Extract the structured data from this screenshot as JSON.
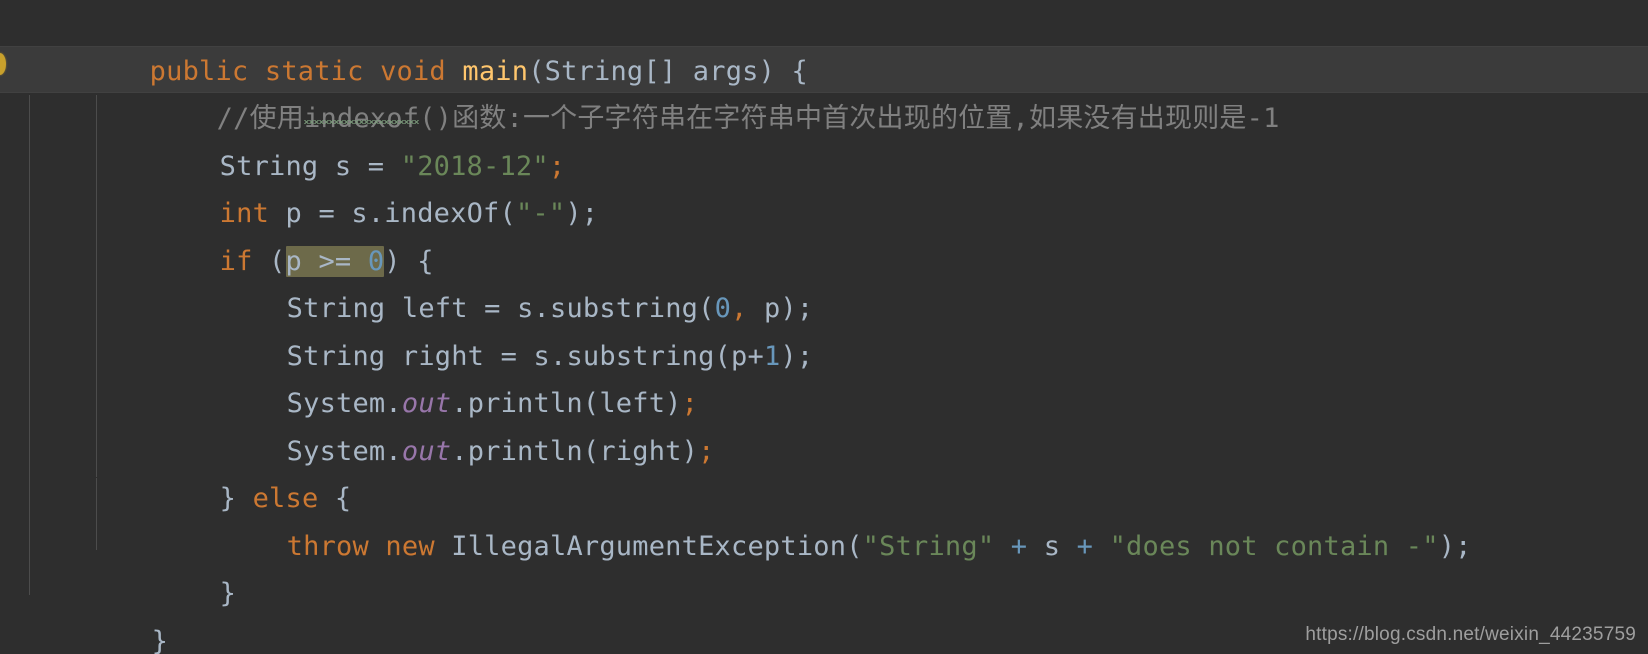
{
  "editor": {
    "language": "Java",
    "theme": "Darcula",
    "colors": {
      "background": "#2e2e2e",
      "current_line": "#3b3b3b",
      "selection": "#6d6a4a",
      "default_text": "#a9b7c6",
      "keyword": "#cc7832",
      "string": "#6a8759",
      "number": "#6897bb",
      "comment": "#808080",
      "static_field": "#9876aa",
      "method_name": "#ffc66d",
      "indent_guide": "#4c4c4c",
      "gutter_marker": "#c8a02c"
    },
    "lines": [
      {
        "n": 1,
        "text": "public static void main(String[] args) {",
        "tokens": {
          "public": "public",
          "static": "static",
          "void": "void",
          "main": "main",
          "open_paren": "(",
          "String_array": "String[]",
          "args": "args",
          "close_paren": ")",
          "open_brace": "{"
        }
      },
      {
        "n": 2,
        "text": "//使用indexof()函数:一个子字符串在字符串中首次出现的位置,如果没有出现则是-1",
        "comment_prefix": "//",
        "comment_part_1": "使用",
        "comment_typo": "indexof",
        "comment_part_2": "()函数:一个子字符串在字符串中首次出现的位置,如果没有出现则是-1",
        "is_current_line": true,
        "has_spell_squiggle": true
      },
      {
        "n": 3,
        "text": "String s = \"2018-12\";",
        "tokens": {
          "type": "String",
          "var": "s",
          "assign": "=",
          "string_literal": "\"2018-12\"",
          "semicolon": ";"
        }
      },
      {
        "n": 4,
        "text": "int p = s.indexOf(\"-\");",
        "tokens": {
          "keyword": "int",
          "var": "p",
          "assign": "=",
          "receiver": "s",
          "method": ".indexOf(",
          "string_literal": "\"-\"",
          "tail": ");"
        }
      },
      {
        "n": 5,
        "text": "if (p >= 0) {",
        "tokens": {
          "keyword": "if",
          "open_paren": "(",
          "selected_var": "p",
          "selected_op": " >= ",
          "selected_num": "0",
          "close_paren": ")",
          "open_brace": "{"
        },
        "has_selection": true,
        "selection_text": "p >= 0"
      },
      {
        "n": 6,
        "text": "String left = s.substring(0, p);",
        "tokens": {
          "type": "String",
          "var": "left",
          "assign": "=",
          "expr_a": "s.substring(",
          "num": "0",
          "comma": ",",
          "arg": " p",
          "tail": ");"
        }
      },
      {
        "n": 7,
        "text": "String right = s.substring(p+1);",
        "tokens": {
          "type": "String",
          "var": "right",
          "assign": "=",
          "expr_a": "s.substring(p+",
          "num": "1",
          "tail": ");"
        }
      },
      {
        "n": 8,
        "text": "System.out.println(left);",
        "tokens": {
          "class": "System",
          "dot1": ".",
          "static_field": "out",
          "call": ".println(left)",
          "semicolon": ";"
        }
      },
      {
        "n": 9,
        "text": "System.out.println(right);",
        "tokens": {
          "class": "System",
          "dot1": ".",
          "static_field": "out",
          "call": ".println(right)",
          "semicolon": ";"
        }
      },
      {
        "n": 10,
        "text": "} else {",
        "tokens": {
          "close_brace": "}",
          "keyword": "else",
          "open_brace": "{"
        }
      },
      {
        "n": 11,
        "text": "throw new IllegalArgumentException(\"String\" + s + \"does not contain -\");",
        "tokens": {
          "throw": "throw",
          "new": "new",
          "exception_type": "IllegalArgumentException",
          "open_paren": "(",
          "string_1": "\"String\"",
          "plus_1": "+",
          "var": "s",
          "plus_2": "+",
          "string_2": "\"does not contain -\"",
          "tail": ");"
        }
      },
      {
        "n": 12,
        "text": "}"
      },
      {
        "n": 13,
        "text": "}"
      }
    ]
  },
  "watermark": {
    "url": "https://blog.csdn.net/weixin_44235759"
  }
}
